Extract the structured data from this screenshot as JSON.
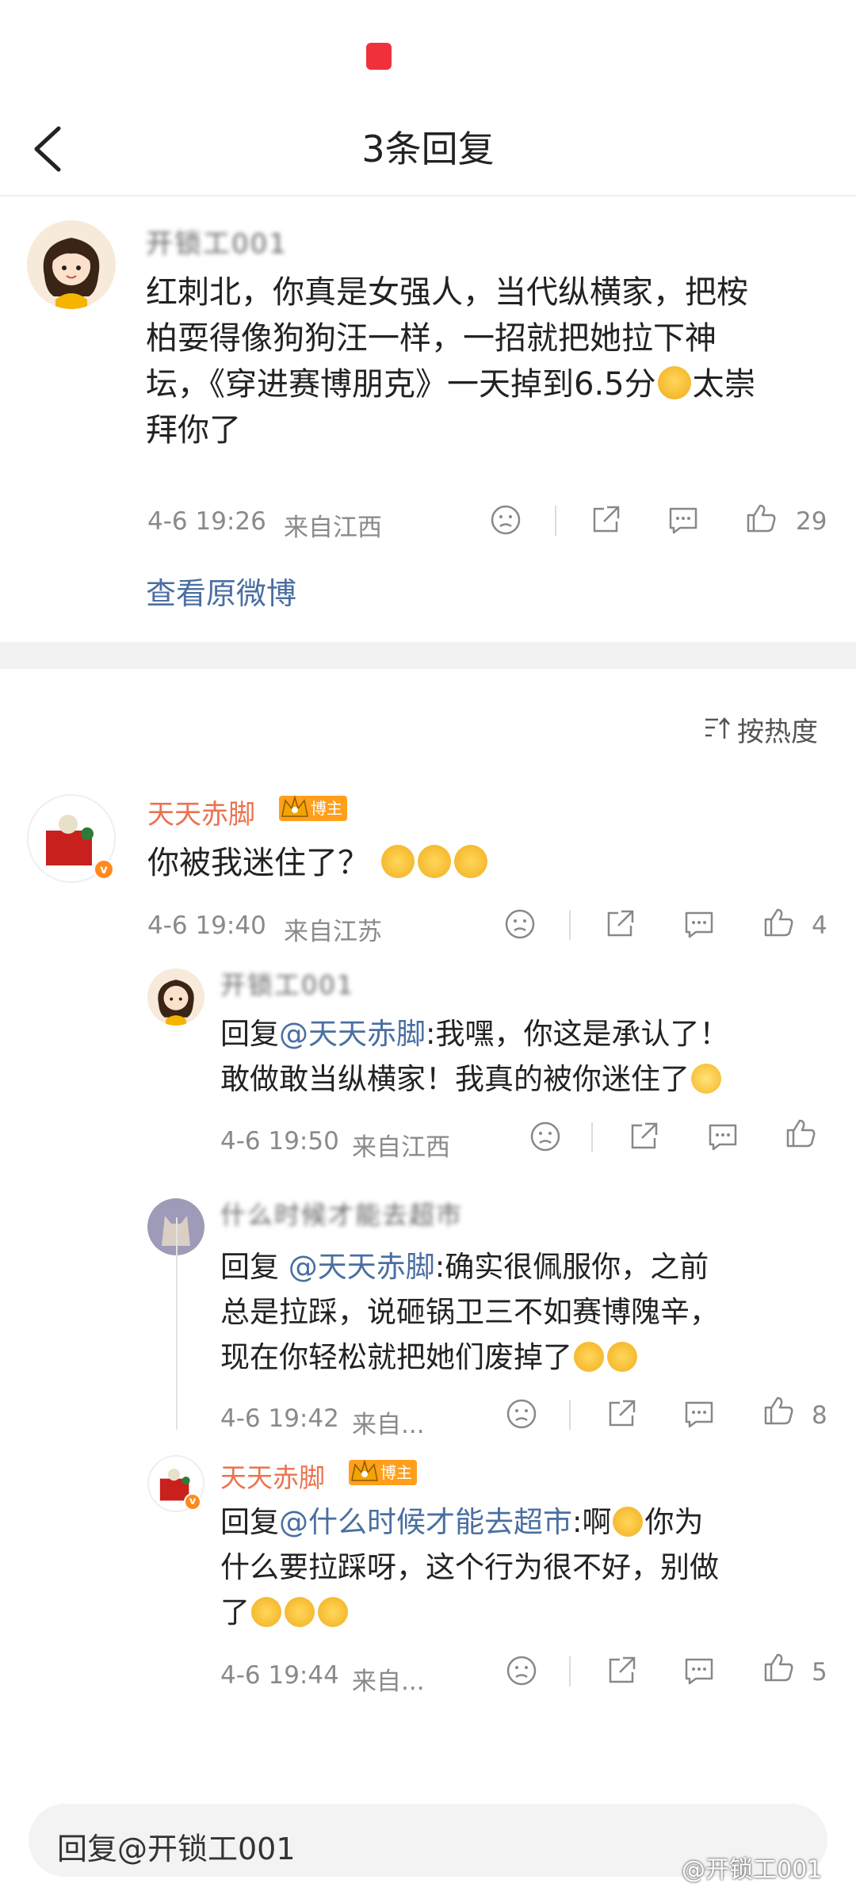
{
  "header": {
    "title": "3条回复"
  },
  "main_comment": {
    "username": "开锁工001",
    "text_line1": "红刺北，你真是女强人，当代纵横家，把桉",
    "text_line2": "柏耍得像狗狗汪一样，一招就把她拉下神",
    "text_line3a": "坛，《穿进赛博朋克》一天掉到6.5分",
    "text_line3b": "太崇",
    "text_line4": "拜你了",
    "time": "4-6 19:26",
    "location": "来自江西",
    "likes": "29"
  },
  "view_original": "查看原微博",
  "sort_label": "按热度",
  "replies": [
    {
      "username": "天天赤脚",
      "badge": "博主",
      "text": "你被我迷住了？",
      "time": "4-6 19:40",
      "location": "来自江苏",
      "likes": "4",
      "sub_replies": [
        {
          "username": "开锁工001",
          "prefix": "回复",
          "mention": "@天天赤脚",
          "line1": ":我嘿，你这是承认了！",
          "line2": "敢做敢当纵横家！我真的被你迷住了",
          "time": "4-6 19:50",
          "location": "来自江西",
          "likes": ""
        },
        {
          "username": "什么时候才能去超市",
          "prefix": "回复 ",
          "mention": "@天天赤脚",
          "line1": ":确实很佩服你，之前",
          "line2": "总是拉踩，说砸锅卫三不如赛博隗辛，",
          "line3": "现在你轻松就把她们废掉了",
          "time": "4-6 19:42",
          "location": "来自...",
          "likes": "8"
        },
        {
          "username": "天天赤脚",
          "badge": "博主",
          "prefix": "回复",
          "mention": "@什么时候才能去超市",
          "line1a": ":啊",
          "line1b": "你为",
          "line2": "什么要拉踩呀，这个行为很不好，别做",
          "line3": "了",
          "time": "4-6 19:44",
          "location": "来自...",
          "likes": "5"
        }
      ]
    }
  ],
  "reply_input": {
    "placeholder": "回复@开锁工001"
  },
  "watermark": "@开锁工001",
  "icons": [
    "back-icon",
    "dislike-icon",
    "share-icon",
    "comment-icon",
    "like-icon",
    "sort-icon"
  ],
  "colors": {
    "mention": "#4a6fa1",
    "username_blogger": "#eb7350",
    "badge": "#ff9f1c",
    "meta": "#8a8a8a"
  }
}
